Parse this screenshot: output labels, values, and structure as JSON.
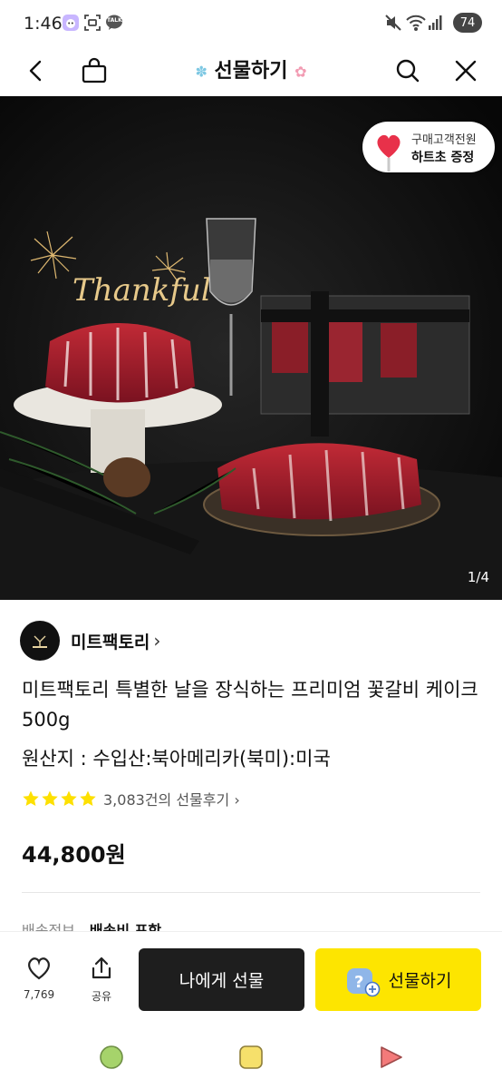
{
  "status_bar": {
    "time": "1:46",
    "talk_label": "TALK",
    "battery": "74"
  },
  "nav": {
    "title": "선물하기"
  },
  "hero": {
    "promo_line1": "구매고객전원",
    "promo_line2": "하트초 증정",
    "topper_text": "Thankful",
    "page_indicator": "1/4"
  },
  "product": {
    "brand_name": "미트팩토리",
    "title": "미트팩토리 특별한 날을 장식하는 프리미엄 꽃갈비 케이크 500g",
    "origin": "원산지 : 수입산:북아메리카(북미):미국",
    "rating_stars": 4,
    "review_count_text": "3,083건의 선물후기",
    "price": "44,800원",
    "shipping_label": "배송정보",
    "shipping_value": "배송비 포함"
  },
  "actions": {
    "wish_count": "7,769",
    "share_label": "공유",
    "gift_self_label": "나에게 선물",
    "gift_label": "선물하기"
  },
  "colors": {
    "accent_yellow": "#fde500",
    "dark_button": "#1e1e1e",
    "star": "#fde000"
  }
}
